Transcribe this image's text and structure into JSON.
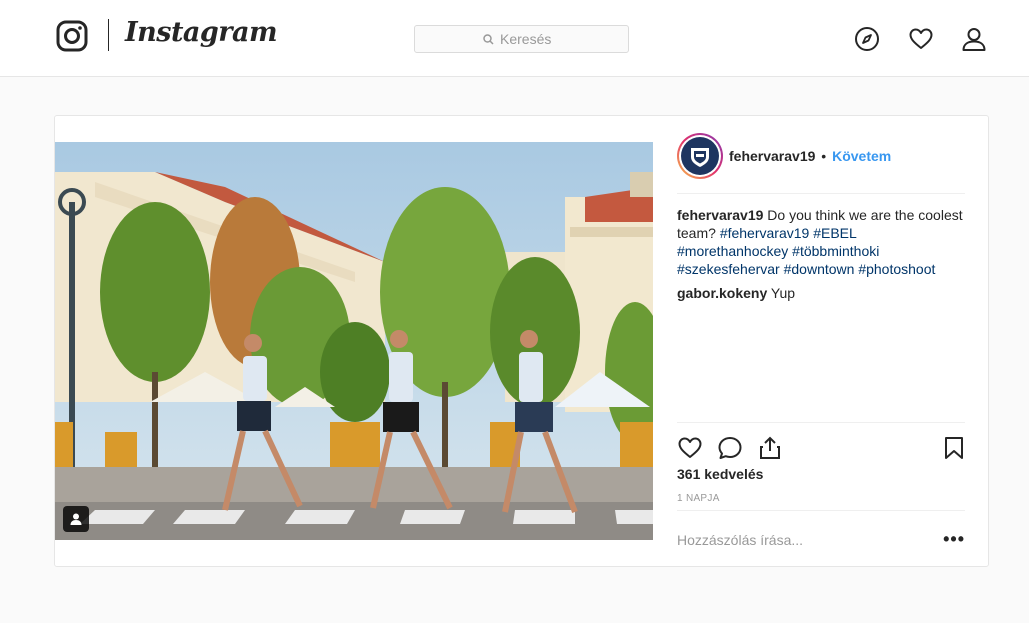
{
  "nav": {
    "wordmark": "Instagram",
    "search_placeholder": "Keresés",
    "icons": [
      "instagram-logo-icon",
      "compass-icon",
      "heart-icon",
      "person-icon"
    ]
  },
  "post": {
    "author": "fehervarav19",
    "dot": "•",
    "follow_label": "Követem",
    "caption": {
      "username": "fehervarav19",
      "text": "Do you think we are the coolest team?",
      "hashtags": "#fehervarav19 #EBEL #morethanhockey #többminthoki #szekesfehervar #downtown #photoshoot"
    },
    "comments": [
      {
        "username": "gabor.kokeny",
        "text": "Yup"
      }
    ],
    "likes": "361 kedvelés",
    "age": "1 NAPJA",
    "comment_placeholder": "Hozzászólás írása...",
    "more_label": "•••"
  },
  "colors": {
    "accent": "#3897f0",
    "hashtag": "#003569",
    "text": "#262626",
    "muted": "#999999",
    "border": "#e6e6e6",
    "background": "#fafafa"
  }
}
